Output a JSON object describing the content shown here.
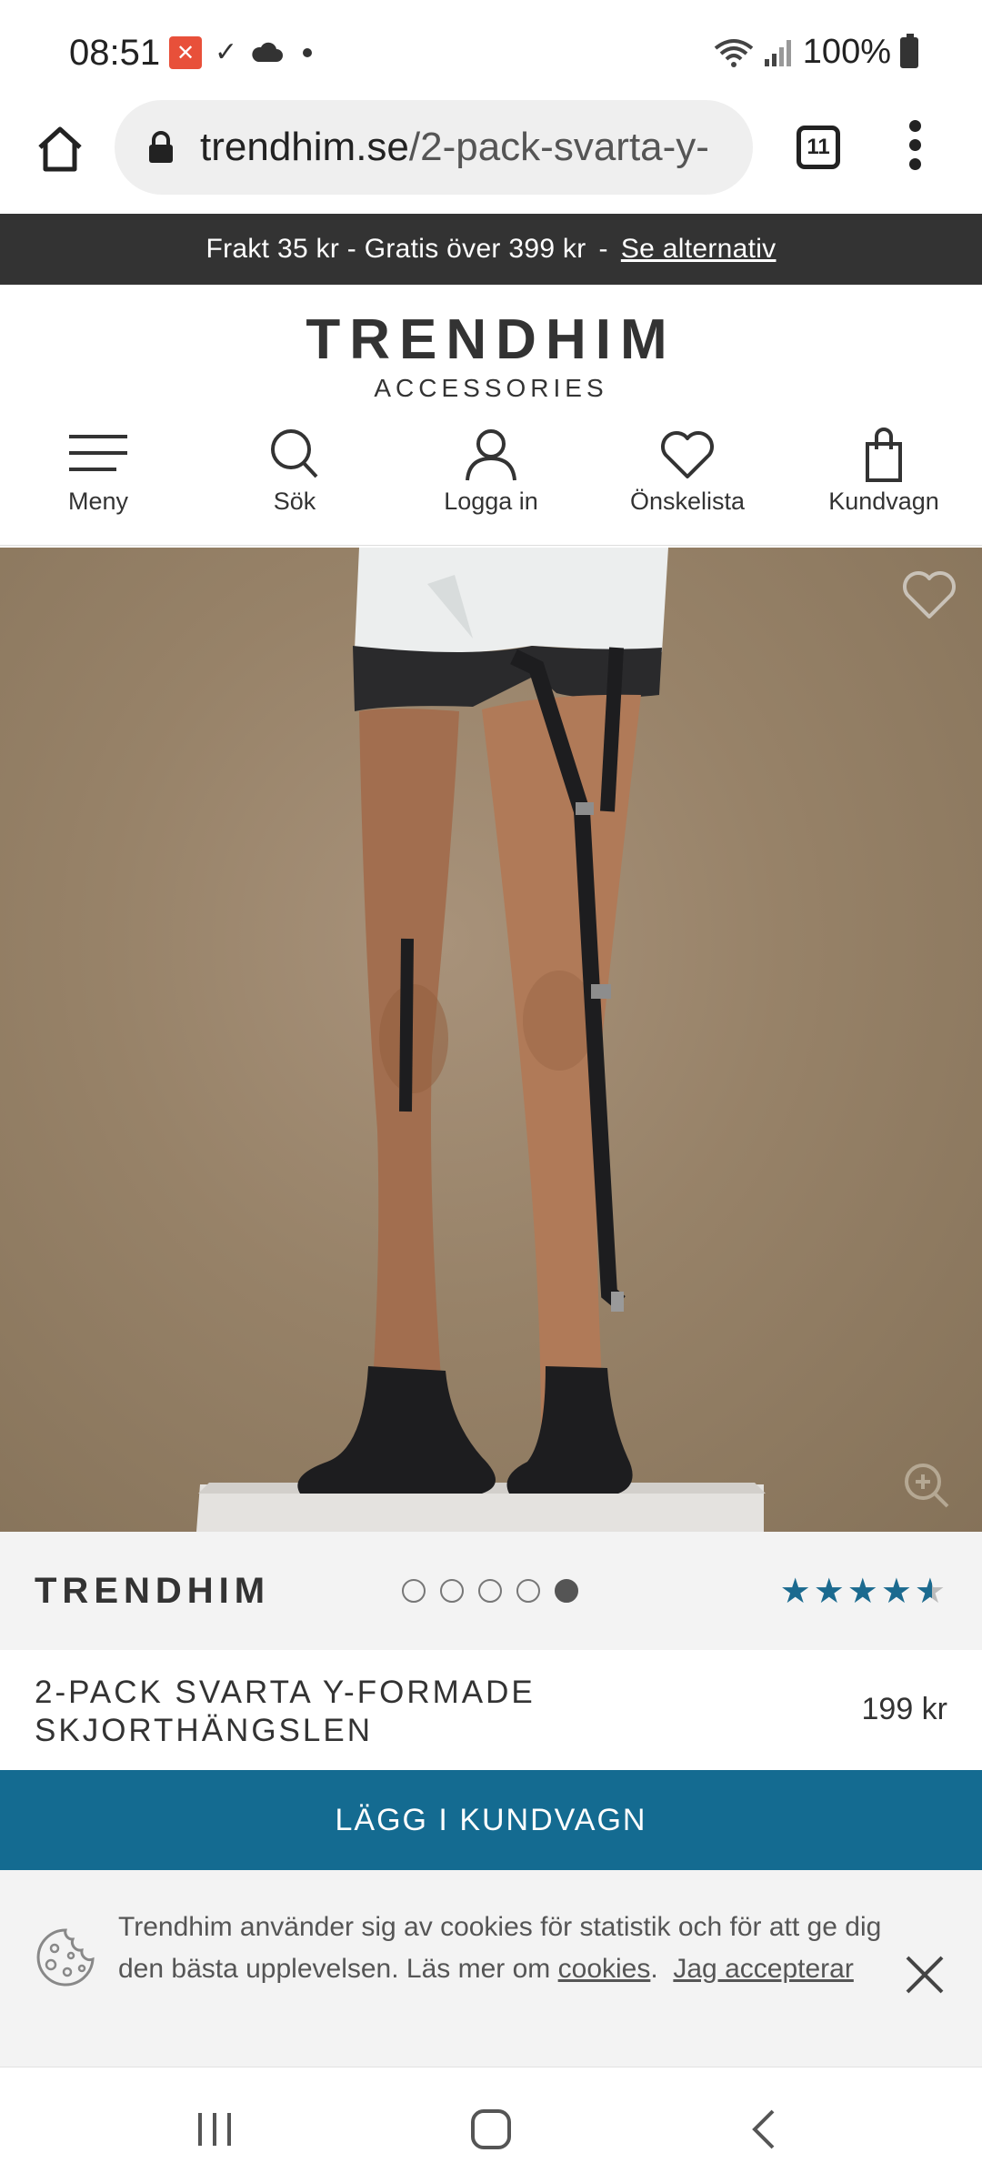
{
  "status_bar": {
    "time": "08:51",
    "battery": "100%",
    "icons": [
      "app-notification-icon",
      "checkmark-icon",
      "cloud-icon",
      "dot-icon",
      "wifi-icon",
      "signal-icon",
      "battery-icon"
    ]
  },
  "browser": {
    "url_domain": "trendhim.se",
    "url_path": "/2-pack-svarta-y-",
    "tab_count": "11"
  },
  "shipping_banner": {
    "text": "Frakt 35 kr - Gratis över 399 kr",
    "separator": "-",
    "link": "Se alternativ"
  },
  "logo": {
    "main": "TRENDHIM",
    "sub": "ACCESSORIES"
  },
  "nav": {
    "items": [
      {
        "label": "Meny",
        "icon": "menu-icon"
      },
      {
        "label": "Sök",
        "icon": "search-icon"
      },
      {
        "label": "Logga in",
        "icon": "user-icon"
      },
      {
        "label": "Önskelista",
        "icon": "heart-icon"
      },
      {
        "label": "Kundvagn",
        "icon": "bag-icon"
      }
    ]
  },
  "gallery": {
    "image_count": 5,
    "active_index": 4
  },
  "product": {
    "brand": "TRENDHIM",
    "rating": 4.5,
    "title": "2-PACK SVARTA Y-FORMADE SKJORTHÄNGSLEN",
    "price": "199 kr",
    "add_to_cart": "LÄGG I KUNDVAGN"
  },
  "cookie_banner": {
    "text": "Trendhim använder sig av cookies för statistik och för att ge dig den bästa upplevelsen. Läs mer om",
    "link_cookies": "cookies",
    "period": ".",
    "link_accept": "Jag accepterar"
  },
  "colors": {
    "accent": "#146b91",
    "banner": "#333333",
    "star": "#1b6a8f"
  }
}
